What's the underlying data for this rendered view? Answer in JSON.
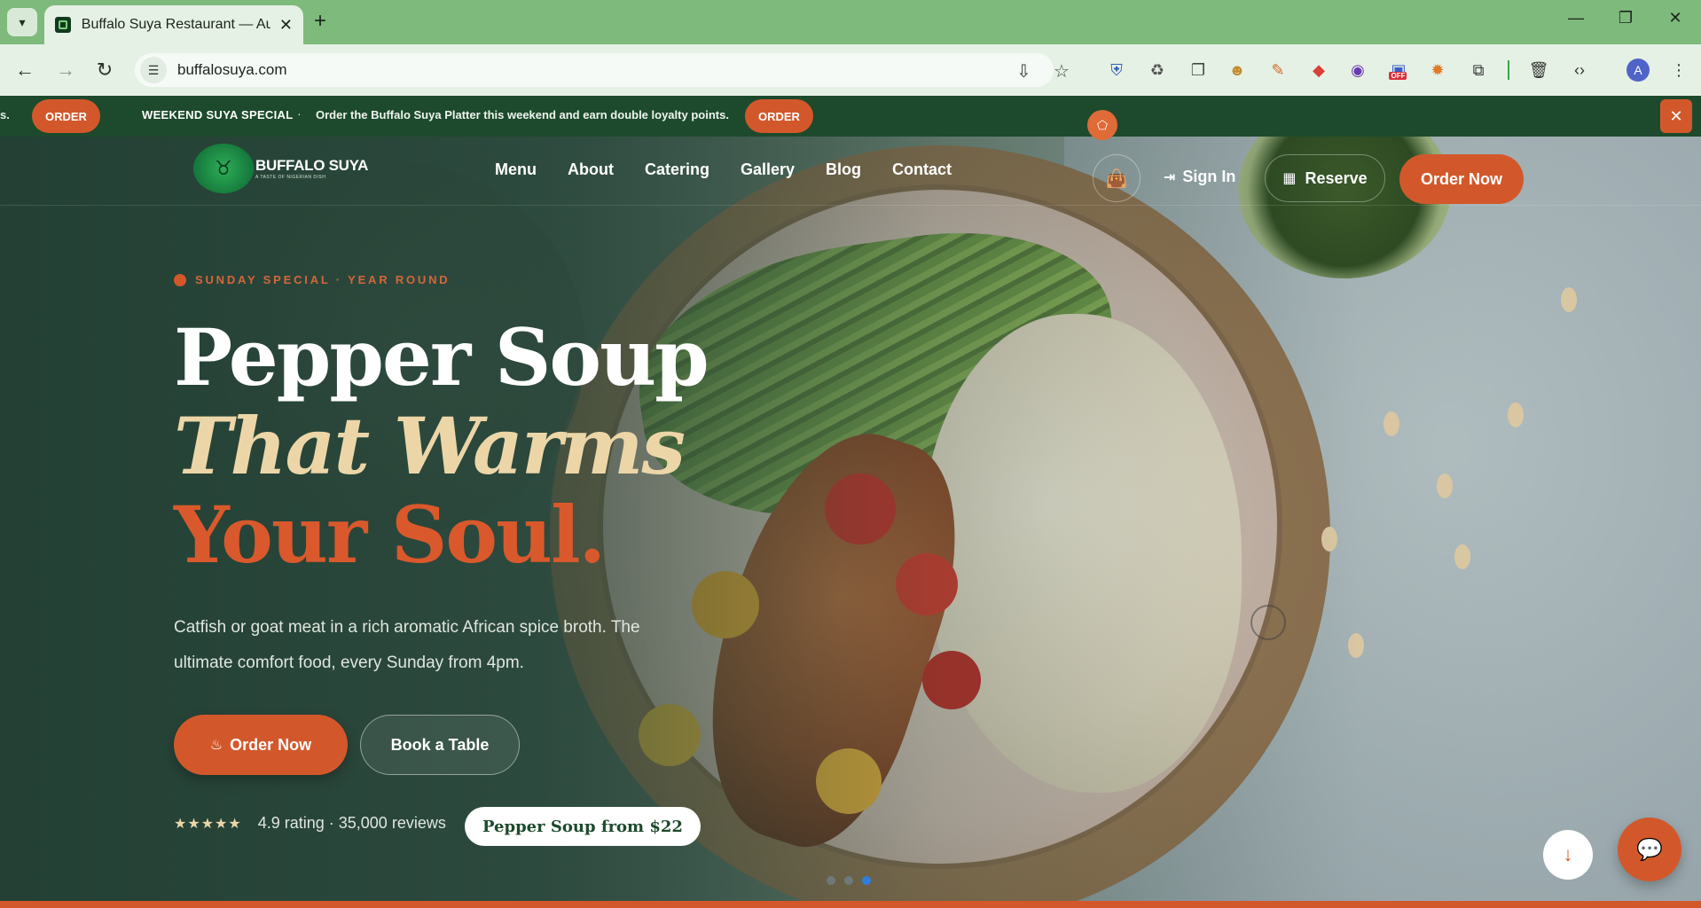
{
  "browser": {
    "tab_title": "Buffalo Suya Restaurant — Authentic",
    "url": "buffalosuya.com",
    "tab_close": "✕",
    "new_tab": "+",
    "window_controls": [
      "—",
      "❐",
      "✕"
    ],
    "profile_initial": "A",
    "extensions": [
      "shield-icon",
      "puzzle-recycle-icon",
      "copy-icon",
      "person-icon",
      "pen-icon",
      "eraser-icon",
      "color-picker-icon",
      "blocker-off-icon",
      "sparkle-icon",
      "extensions-icon",
      "trash-icon",
      "code-icon"
    ],
    "blocker_badge": "OFF"
  },
  "announcement": {
    "fragment": "s.",
    "left_pill": "ORDER",
    "title": "WEEKEND SUYA SPECIAL",
    "separator": "·",
    "text": "Order the Buffalo Suya Platter this weekend and earn double loyalty points.",
    "right_pill": "ORDER",
    "close": "✕"
  },
  "header": {
    "logo_name": "BUFFALO SUYA",
    "logo_tagline": "A TASTE OF NIGERIAN DISH",
    "nav": [
      "Menu",
      "About",
      "Catering",
      "Gallery",
      "Blog",
      "Contact"
    ],
    "sign_in": "Sign In",
    "reserve": "Reserve",
    "order_now": "Order Now"
  },
  "hero": {
    "eyebrow": "SUNDAY SPECIAL · YEAR ROUND",
    "headline_1": "Pepper Soup",
    "headline_2": "That Warms",
    "headline_3": "Your Soul.",
    "lede": "Catfish or goat meat in a rich aromatic African spice broth. The ultimate comfort food, every Sunday from 4pm.",
    "order_button": "Order Now",
    "book_button": "Book a Table",
    "stars": "★★★★★",
    "rating_text": "4.9 rating · 35,000 reviews",
    "price_pill": "Pepper Soup from $22",
    "slides_total": 3,
    "active_slide": 3
  },
  "colors": {
    "accent": "#d2582b",
    "brand_green": "#1d4a2c",
    "cream": "#ecd6a8"
  }
}
